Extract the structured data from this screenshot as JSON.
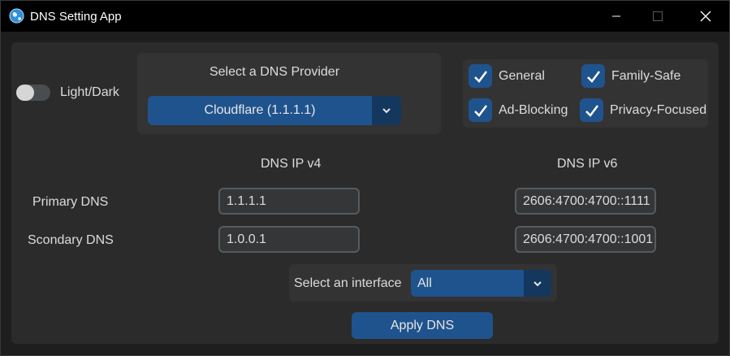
{
  "window": {
    "title": "DNS Setting App",
    "app_icon": "globe-icon"
  },
  "theme_toggle": {
    "label": "Light/Dark",
    "state": "off"
  },
  "provider": {
    "heading": "Select a DNS Provider",
    "selected": "Cloudflare (1.1.1.1)"
  },
  "filters": [
    {
      "label": "General",
      "checked": true
    },
    {
      "label": "Family-Safe",
      "checked": true
    },
    {
      "label": "Ad-Blocking",
      "checked": true
    },
    {
      "label": "Privacy-Focused",
      "checked": true
    }
  ],
  "dns": {
    "v4_heading": "DNS IP v4",
    "v6_heading": "DNS IP v6",
    "primary_label": "Primary DNS",
    "secondary_label": "Scondary DNS",
    "primary_v4": "1.1.1.1",
    "secondary_v4": "1.0.0.1",
    "primary_v6": "2606:4700:4700::1111",
    "secondary_v6": "2606:4700:4700::1001"
  },
  "interface": {
    "label": "Select an interface",
    "selected": "All"
  },
  "apply_button": "Apply DNS",
  "colors": {
    "accent": "#1f538d",
    "accent_dark": "#14375e",
    "background": "#2b2b2b",
    "frame": "#333333"
  }
}
